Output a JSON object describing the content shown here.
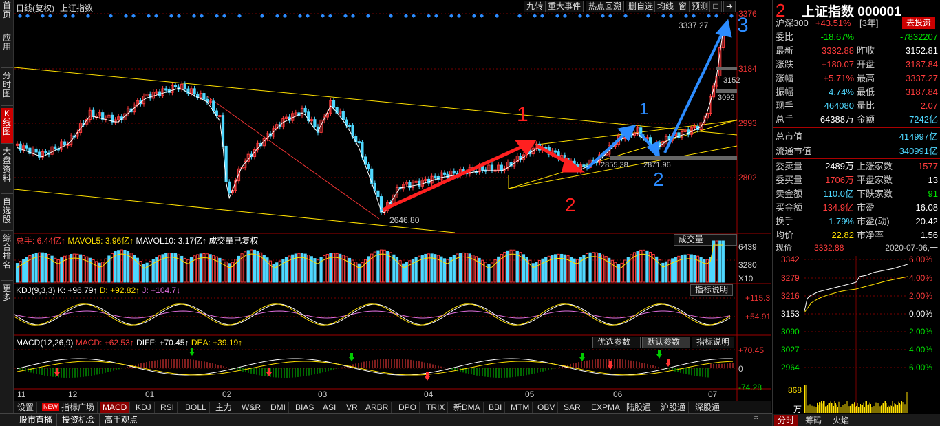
{
  "sidebar": {
    "items": [
      "首页",
      "应用",
      "分时图",
      "K线图",
      "大盘资料",
      "自选股",
      "综合排名",
      "更多"
    ]
  },
  "header": {
    "title": "日线(复权)",
    "index_name": "上证指数",
    "buttons": [
      "九转",
      "重大事件",
      "热点回溯",
      "删自选",
      "均线",
      "窗",
      "预测"
    ]
  },
  "price_axis": [
    "3376",
    "3184",
    "2993",
    "2802"
  ],
  "annotations": {
    "high_label": "3337.27",
    "low_label": "2646.80",
    "mid_label": "2855.38",
    "mid_label2": "2871.96",
    "right_label1": "3152",
    "right_label2": "3092",
    "hand_notes": [
      "1",
      "1",
      "2",
      "2",
      "3",
      "2"
    ]
  },
  "volume_panel": {
    "header_total_label": "总手: 6.44亿↑",
    "header_mavol5": "MAVOL5: 3.96亿↑",
    "header_mavol10": "MAVOL10: 3.17亿↑",
    "header_note": "成交量已复权",
    "dropdown": "成交量",
    "axis": [
      "6439",
      "3280",
      "X10"
    ]
  },
  "kdj_panel": {
    "title": "KDJ(9,3,3)",
    "k": "K: +96.79↑",
    "d": "D: +92.82↑",
    "j": "J: +104.7↓",
    "explain_btn": "指标说明",
    "axis": [
      "+115.3",
      "+54.91"
    ]
  },
  "macd_panel": {
    "title": "MACD(12,26,9)",
    "macd": "MACD: +62.53↑",
    "diff": "DIFF: +70.45↑",
    "dea": "DEA: +39.19↑",
    "btn_optimal": "优选参数",
    "btn_default": "默认参数",
    "explain_btn": "指标说明",
    "axis": [
      "+70.45",
      "0",
      "-74.28"
    ]
  },
  "x_axis": [
    "11",
    "12",
    "01",
    "02",
    "03",
    "04",
    "05",
    "06",
    "07"
  ],
  "indicator_tabs": [
    "设置",
    "指标广场",
    "MACD",
    "KDJ",
    "RSI",
    "BOLL",
    "主力",
    "W&R",
    "DMI",
    "BIAS",
    "ASI",
    "VR",
    "ARBR",
    "DPO",
    "TRIX",
    "新DMA",
    "BBI",
    "MTM",
    "OBV",
    "SAR",
    "EXPMA",
    "陆股通",
    "沪股通",
    "深股通"
  ],
  "new_badge": "NEW",
  "footer_tabs": [
    "股市直播",
    "投资机会",
    "高手观点"
  ],
  "right": {
    "title": "上证指数 000001",
    "related": "沪深300",
    "related_pct": "+43.51%",
    "related_period": "[3年]",
    "invest_btn": "去投资",
    "rows": [
      {
        "l1": "委比",
        "v1": "-18.67%",
        "c1": "green",
        "v2": "-7832207",
        "c2": "green"
      },
      {
        "l1": "最新",
        "v1": "3332.88",
        "c1": "red",
        "l2": "昨收",
        "v2": "3152.81",
        "c2": "white"
      },
      {
        "l1": "涨跌",
        "v1": "+180.07",
        "c1": "red",
        "l2": "开盘",
        "v2": "3187.84",
        "c2": "red"
      },
      {
        "l1": "涨幅",
        "v1": "+5.71%",
        "c1": "red",
        "l2": "最高",
        "v2": "3337.27",
        "c2": "red"
      },
      {
        "l1": "振幅",
        "v1": "4.74%",
        "c1": "cyan",
        "l2": "最低",
        "v2": "3187.84",
        "c2": "red"
      },
      {
        "l1": "现手",
        "v1": "464080",
        "c1": "cyan",
        "l2": "量比",
        "v2": "2.07",
        "c2": "red"
      },
      {
        "l1": "总手",
        "v1": "64388万",
        "c1": "white",
        "l2": "金额",
        "v2": "7242亿",
        "c2": "cyan"
      }
    ],
    "mktcap_total_label": "总市值",
    "mktcap_total": "414997亿",
    "mktcap_float_label": "流通市值",
    "mktcap_float": "340991亿",
    "rows2": [
      {
        "l1": "委卖量",
        "v1": "2489万",
        "c1": "white",
        "l2": "上涨家数",
        "v2": "1577",
        "c2": "red"
      },
      {
        "l1": "委买量",
        "v1": "1706万",
        "c1": "red",
        "l2": "平盘家数",
        "v2": "13",
        "c2": "white"
      },
      {
        "l1": "卖金额",
        "v1": "110.0亿",
        "c1": "cyan",
        "l2": "下跌家数",
        "v2": "91",
        "c2": "green"
      },
      {
        "l1": "买金额",
        "v1": "134.9亿",
        "c1": "red",
        "l2": "市盈",
        "v2": "16.08",
        "c2": "white"
      },
      {
        "l1": "换手",
        "v1": "1.79%",
        "c1": "cyan",
        "l2": "市盈(动)",
        "v2": "20.42",
        "c2": "white"
      },
      {
        "l1": "均价",
        "v1": "22.82",
        "c1": "yellow",
        "l2": "市净率",
        "v2": "1.56",
        "c2": "white"
      }
    ],
    "now_label": "现价",
    "now_val": "3332.88",
    "date": "2020-07-06,一",
    "mini_left": [
      "3342",
      "3279",
      "3216",
      "3153",
      "3090",
      "3027",
      "2964",
      "868",
      "万"
    ],
    "mini_right": [
      "6.00%",
      "4.00%",
      "2.00%",
      "0.00%",
      "2.00%",
      "4.00%",
      "6.00%"
    ],
    "tabs": [
      "分时",
      "筹码",
      "火焰"
    ]
  }
}
